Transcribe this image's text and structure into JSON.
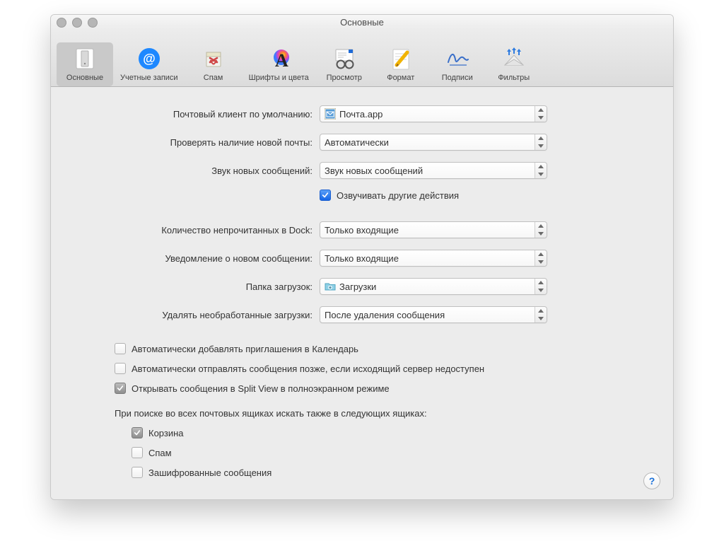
{
  "window": {
    "title": "Основные"
  },
  "toolbar": {
    "items": [
      {
        "label": "Основные",
        "name": "toolbar-general"
      },
      {
        "label": "Учетные записи",
        "name": "toolbar-accounts"
      },
      {
        "label": "Спам",
        "name": "toolbar-junk"
      },
      {
        "label": "Шрифты и цвета",
        "name": "toolbar-fonts"
      },
      {
        "label": "Просмотр",
        "name": "toolbar-viewing"
      },
      {
        "label": "Формат",
        "name": "toolbar-composing"
      },
      {
        "label": "Подписи",
        "name": "toolbar-signatures"
      },
      {
        "label": "Фильтры",
        "name": "toolbar-rules"
      }
    ]
  },
  "settings": {
    "default_client_label": "Почтовый клиент по умолчанию:",
    "default_client_value": "Почта.app",
    "check_mail_label": "Проверять наличие новой почты:",
    "check_mail_value": "Автоматически",
    "new_sound_label": "Звук новых сообщений:",
    "new_sound_value": "Звук новых сообщений",
    "play_other_sounds": "Озвучивать другие действия",
    "dock_count_label": "Количество непрочитанных в Dock:",
    "dock_count_value": "Только входящие",
    "new_notify_label": "Уведомление о новом сообщении:",
    "new_notify_value": "Только входящие",
    "downloads_label": "Папка загрузок:",
    "downloads_value": "Загрузки",
    "remove_dl_label": "Удалять необработанные загрузки:",
    "remove_dl_value": "После удаления сообщения"
  },
  "checkboxes": {
    "auto_calendar": "Автоматически добавлять приглашения в Календарь",
    "auto_send_later": "Автоматически отправлять сообщения позже, если исходящий сервер недоступен",
    "split_view": "Открывать сообщения в Split View в полноэкранном режиме"
  },
  "search": {
    "heading": "При поиске во всех почтовых ящиках искать также в следующих ящиках:",
    "trash": "Корзина",
    "junk": "Спам",
    "encrypted": "Зашифрованные сообщения"
  },
  "help": "?"
}
